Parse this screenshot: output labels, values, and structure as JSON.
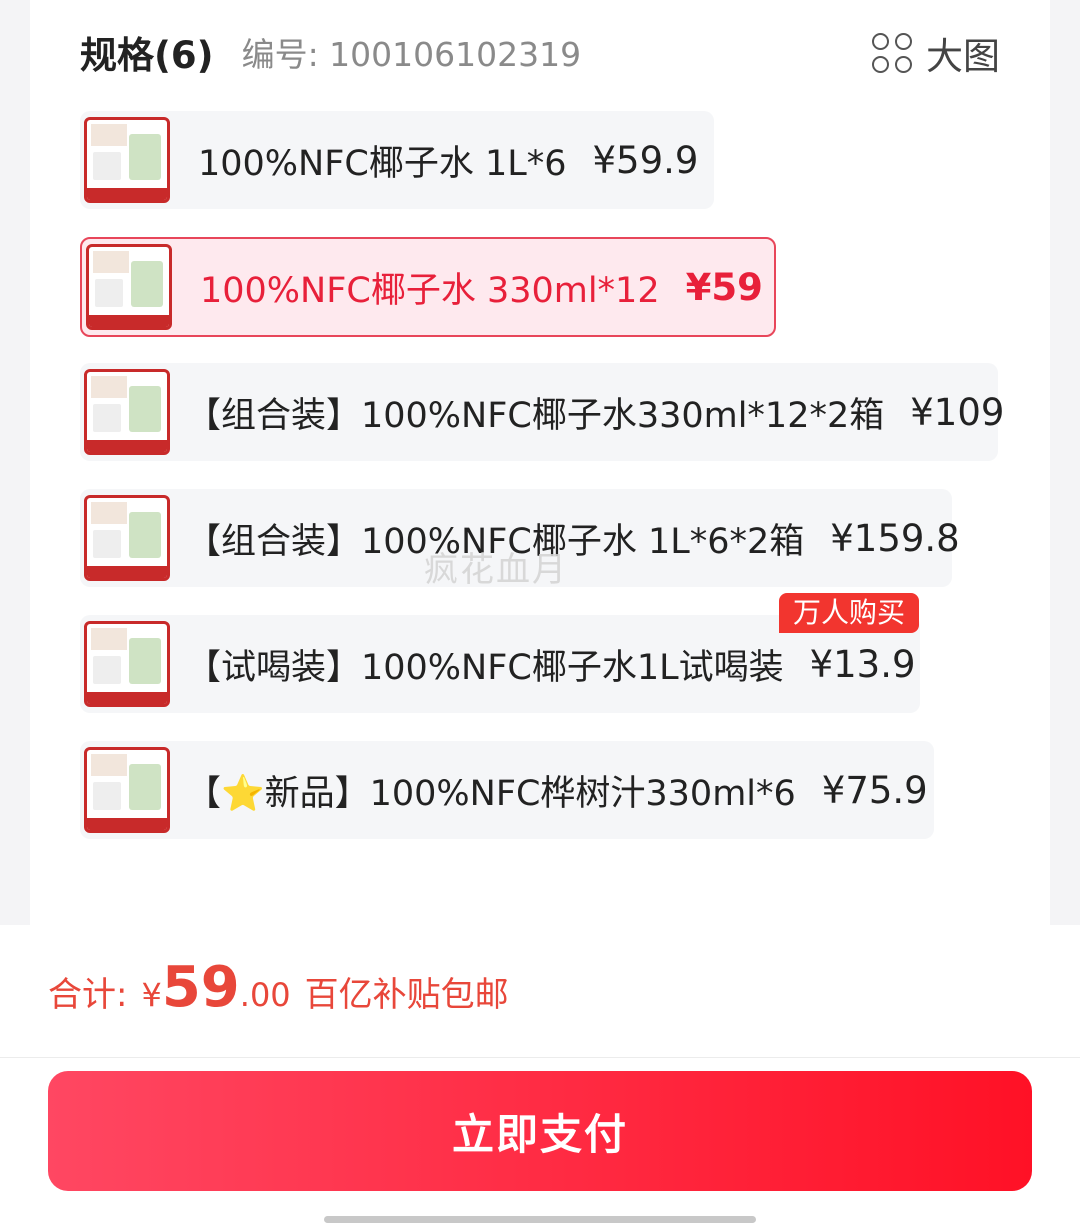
{
  "header": {
    "title": "规格(6)",
    "code": "编号: 100106102319",
    "big_picture_label": "大图",
    "big_picture_icon": "grid-four-circles-icon"
  },
  "options": [
    {
      "label": "100%NFC椰子水 1L*6",
      "price": "¥59.9",
      "selected": false
    },
    {
      "label": "100%NFC椰子水 330ml*12",
      "price": "¥59",
      "selected": true
    },
    {
      "label": "【组合装】100%NFC椰子水330ml*12*2箱",
      "price": "¥109",
      "selected": false
    },
    {
      "label": "【组合装】100%NFC椰子水 1L*6*2箱",
      "price": "¥159.8",
      "selected": false
    },
    {
      "label": "【试喝装】100%NFC椰子水1L试喝装",
      "price": "¥13.9",
      "selected": false
    },
    {
      "label": "【⭐新品】100%NFC桦树汁330ml*6",
      "price": "¥75.9",
      "selected": false
    }
  ],
  "badge": "万人购买",
  "watermark": "疯花血月",
  "footer": {
    "total_label": "合计:",
    "currency": "¥",
    "total_int": "59",
    "total_dec": ".00",
    "note": "百亿补贴包邮",
    "pay_button": "立即支付"
  },
  "colors": {
    "accent": "#e8203a",
    "selected_bg": "#fee9ee",
    "badge_bg": "#f2352f"
  }
}
